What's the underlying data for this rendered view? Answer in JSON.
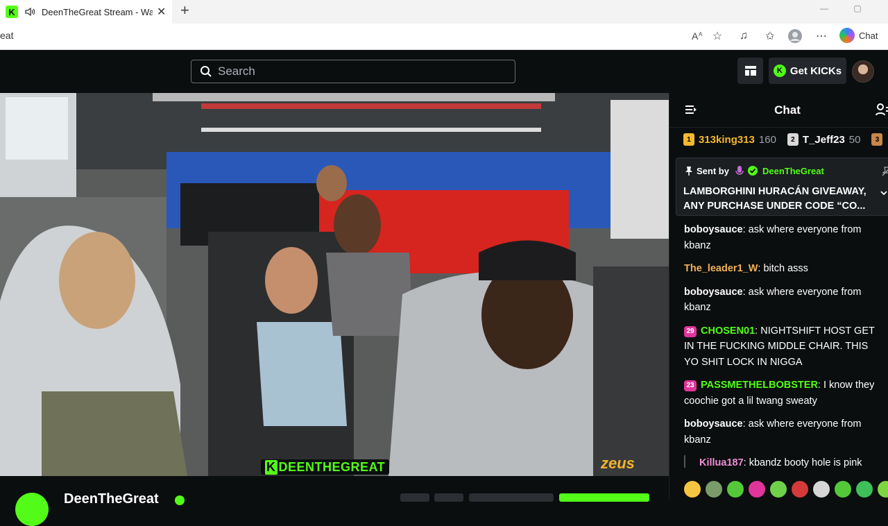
{
  "browser": {
    "tab_title": "DeenTheGreat Stream - Watch",
    "tab_close": "✕",
    "new_tab": "+",
    "url": "eat",
    "copilot_label": "Chat"
  },
  "header": {
    "search_placeholder": "Search",
    "get_kicks_label": "Get KICKs"
  },
  "video": {
    "watermark": "DEENTHEGREAT",
    "watermark_k": "K",
    "sponsor": "zeus"
  },
  "channel": {
    "name": "DeenTheGreat"
  },
  "chat": {
    "title": "Chat",
    "leaderboard": [
      {
        "rank": "1",
        "name": "313king313",
        "value": "160",
        "color": "#f5b82e",
        "name_color": "#f5b82e"
      },
      {
        "rank": "2",
        "name": "T_Jeff23",
        "value": "50",
        "color": "#d9d9d9",
        "name_color": "#ffffff"
      },
      {
        "rank": "3",
        "name": "",
        "value": "",
        "color": "#c9864a",
        "name_color": "#ffffff"
      }
    ],
    "pinned": {
      "sent_by_label": "Sent by",
      "sender": "DeenTheGreat",
      "sender_color": "#53fc18",
      "text": "LAMBORGHINI HURACÁN GIVEAWAY, ANY PURCHASE UNDER CODE “CO..."
    },
    "messages": [
      {
        "user": "boboysauce",
        "color": "#ffffff",
        "text": "ask where everyone from kbanz",
        "badge": ""
      },
      {
        "user": "The_leader1_W",
        "color": "#f2b15a",
        "text": "bitch asss",
        "badge": ""
      },
      {
        "user": "boboysauce",
        "color": "#ffffff",
        "text": "ask where everyone from kbanz",
        "badge": ""
      },
      {
        "user": "CHOSEN01",
        "color": "#53fc18",
        "text": "NIGHTSHIFT HOST GET IN THE FUCKING MIDDLE CHAIR. THIS YO SHIT LOCK IN NIGGA",
        "badge": "29"
      },
      {
        "user": "PASSMETHELBOBSTER",
        "color": "#53fc18",
        "text": "I know they coochie got a lil twang sweaty",
        "badge": "23"
      },
      {
        "user": "boboysauce",
        "color": "#ffffff",
        "text": "ask where everyone from kbanz",
        "badge": ""
      },
      {
        "user": "Killua187",
        "color": "#f08fd4",
        "text": "kbandz booty hole is pink",
        "badge": ""
      }
    ],
    "separator": ": ",
    "emote_colors": [
      "#f5c542",
      "#7a9c6b",
      "#53c93a",
      "#e0359a",
      "#6fd14a",
      "#d43a3a",
      "#d6d6d6",
      "#53c93a",
      "#3fbf5a",
      "#7dd63f"
    ]
  }
}
